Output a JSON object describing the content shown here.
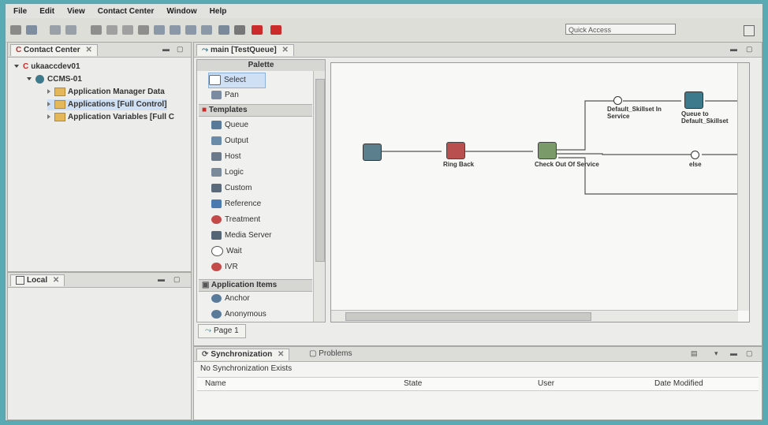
{
  "menu": [
    "File",
    "Edit",
    "View",
    "Contact Center",
    "Window",
    "Help"
  ],
  "toolbar": {
    "quick_access": "Quick Access"
  },
  "contact_center": {
    "tab": "Contact Center",
    "tree": [
      {
        "label": "ukaaccdev01"
      },
      {
        "label": "CCMS-01"
      },
      {
        "label": "Application Manager Data"
      },
      {
        "label": "Applications [Full Control]"
      },
      {
        "label": "Application Variables [Full C"
      }
    ]
  },
  "local": {
    "tab": "Local"
  },
  "editor": {
    "tab": "main [TestQueue]",
    "page_tab": "Page 1"
  },
  "palette": {
    "title": "Palette",
    "tools": [
      "Select",
      "Pan"
    ],
    "templates_header": "Templates",
    "templates": [
      "Queue",
      "Output",
      "Host",
      "Logic",
      "Custom",
      "Reference",
      "Treatment",
      "Media Server",
      "Wait",
      "IVR"
    ],
    "app_items_header": "Application Items",
    "app_items": [
      "Anchor",
      "Anonymous"
    ]
  },
  "canvas": {
    "nodes": [
      "Ring Back",
      "Check Out Of Service",
      "Queue to Default_Skillset"
    ],
    "branches": [
      "Default_Skillset In Service",
      "else"
    ]
  },
  "sync": {
    "tab": "Synchronization",
    "tab2": "Problems",
    "status": "No Synchronization Exists",
    "columns": [
      "Name",
      "State",
      "User",
      "Date Modified"
    ]
  },
  "colors": {
    "accent_red": "#cc2b2b",
    "folder": "#e4b85a",
    "selection": "#cfe0f4"
  }
}
